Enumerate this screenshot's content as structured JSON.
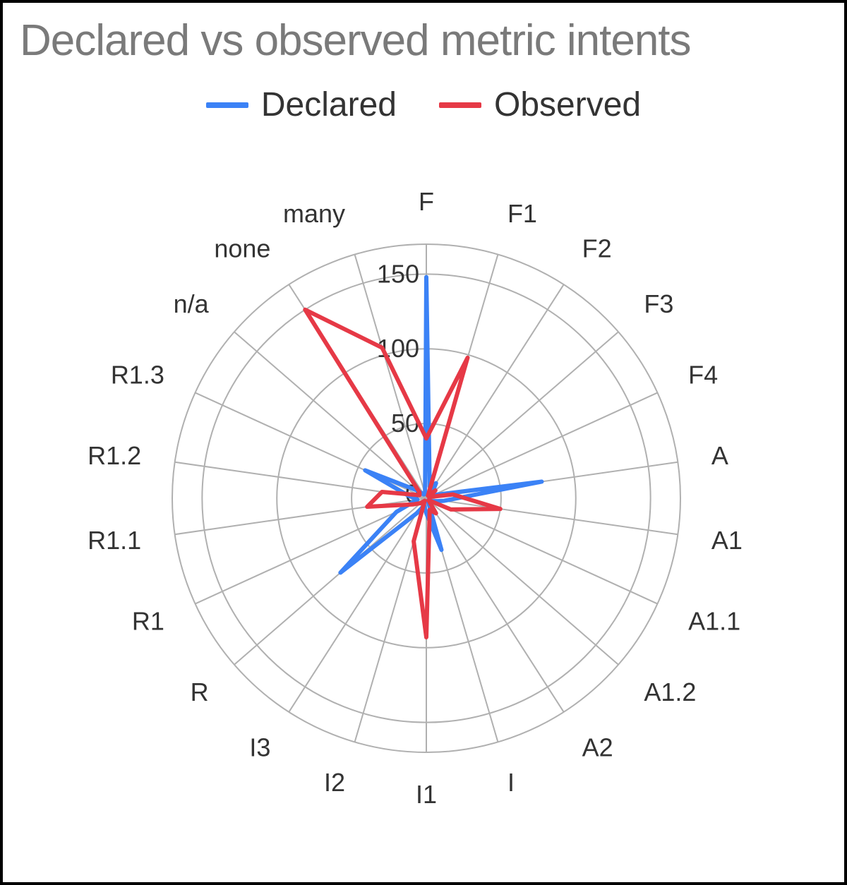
{
  "chart_data": {
    "type": "radar",
    "title": "Declared vs observed metric intents",
    "categories": [
      "F",
      "F1",
      "F2",
      "F3",
      "F4",
      "A",
      "A1",
      "A1.1",
      "A1.2",
      "A2",
      "I",
      "I1",
      "I2",
      "I3",
      "R",
      "R1",
      "R1.1",
      "R1.2",
      "R1.3",
      "n/a",
      "none",
      "many"
    ],
    "ticks": [
      0,
      50,
      100,
      150
    ],
    "rmax": 170,
    "series": [
      {
        "name": "Declared",
        "color": "#3b82f6",
        "values": [
          148,
          8,
          12,
          5,
          5,
          78,
          12,
          5,
          2,
          2,
          36,
          10,
          5,
          12,
          76,
          22,
          6,
          12,
          45,
          8,
          3,
          3
        ]
      },
      {
        "name": "Observed",
        "color": "#e63946",
        "values": [
          40,
          98,
          2,
          8,
          2,
          18,
          50,
          18,
          2,
          12,
          8,
          93,
          30,
          2,
          5,
          10,
          40,
          30,
          5,
          6,
          150,
          105
        ]
      }
    ],
    "legend_position": "top"
  },
  "title": "Declared vs observed metric intents",
  "legend": {
    "items": [
      {
        "label": "Declared",
        "color": "#3b82f6"
      },
      {
        "label": "Observed",
        "color": "#e63946"
      }
    ]
  },
  "ticks": [
    "0",
    "50",
    "100",
    "150"
  ]
}
